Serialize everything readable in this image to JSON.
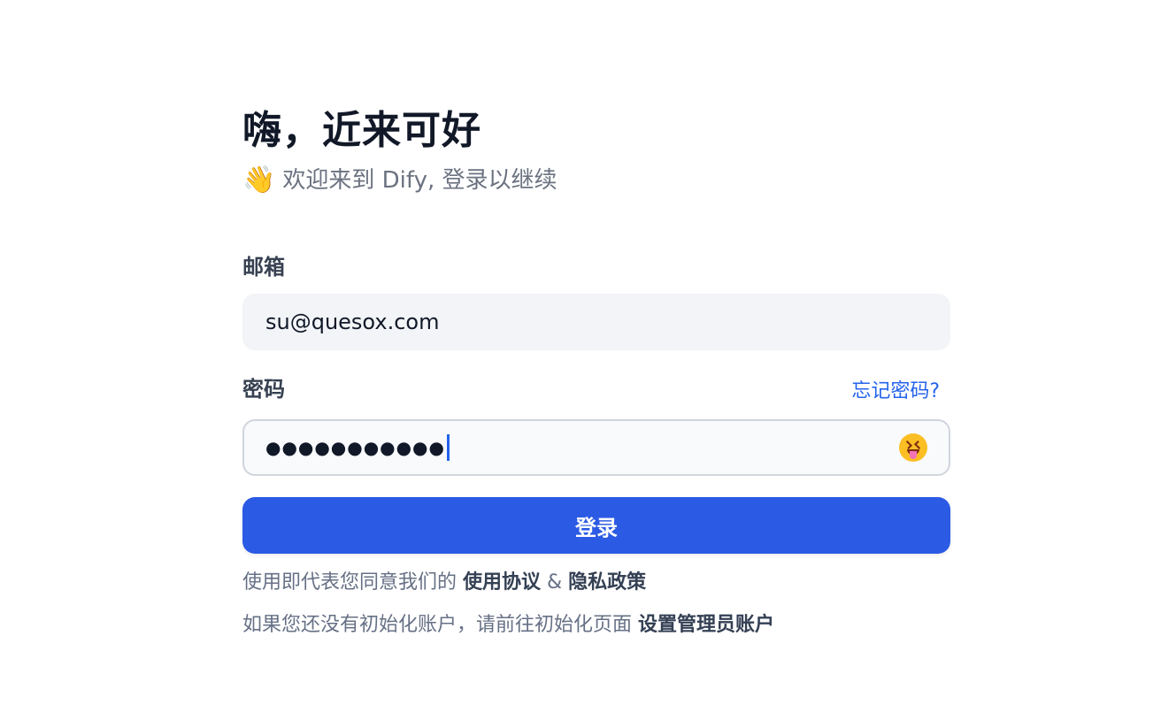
{
  "header": {
    "title": "嗨，近来可好",
    "subtitle_emoji": "👋",
    "subtitle": "欢迎来到 Dify, 登录以继续"
  },
  "email": {
    "label": "邮箱",
    "value": "su@quesox.com"
  },
  "password": {
    "label": "密码",
    "forgot_label": "忘记密码?",
    "masked_value": "●●●●●●●●●●●",
    "toggle_icon": "squinting-tongue-face-icon"
  },
  "login_button": {
    "label": "登录"
  },
  "terms": {
    "prefix": "使用即代表您同意我们的 ",
    "terms_link": "使用协议",
    "separator": " & ",
    "privacy_link": "隐私政策"
  },
  "setup": {
    "prefix": "如果您还没有初始化账户，请前往初始化页面 ",
    "link": "设置管理员账户"
  },
  "colors": {
    "accent": "#2b5ae4",
    "link": "#2563eb",
    "input_bg": "#f2f4f7"
  }
}
